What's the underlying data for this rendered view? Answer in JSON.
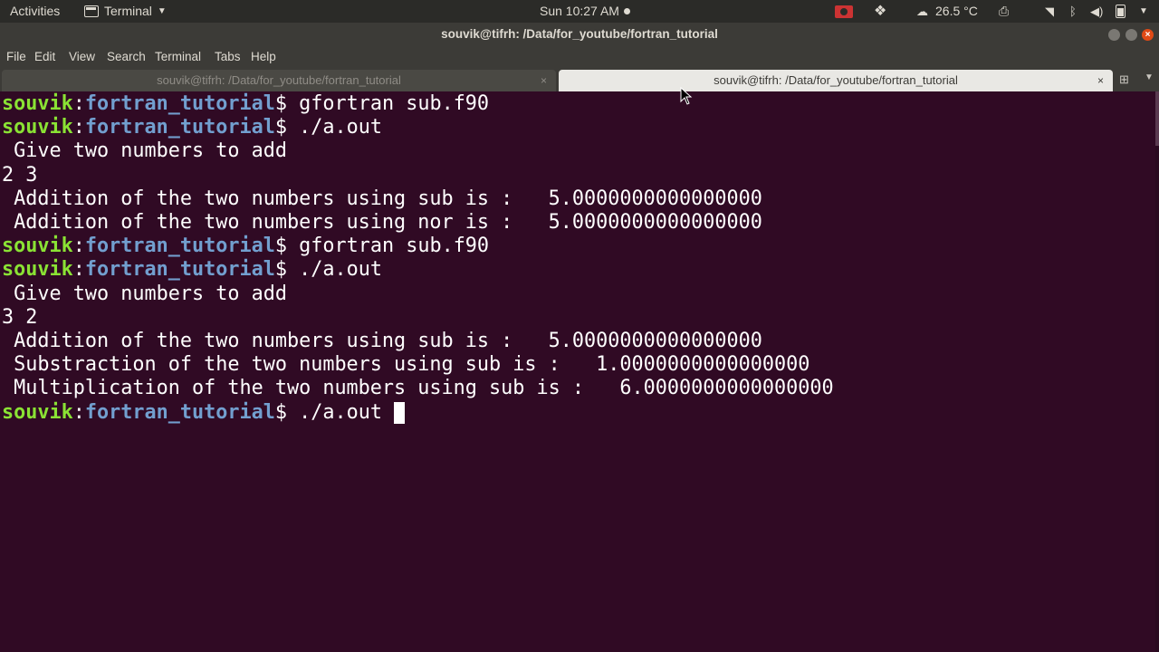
{
  "topbar": {
    "activities": "Activities",
    "app_name": "Terminal",
    "clock": "Sun 10:27 AM",
    "temperature": "26.5 °C",
    "icons": [
      "screen-record-icon",
      "dropbox-icon",
      "weather-icon",
      "printer-icon",
      "wifi-icon",
      "bluetooth-icon",
      "volume-icon",
      "battery-icon"
    ]
  },
  "window": {
    "title": "souvik@tifrh: /Data/for_youtube/fortran_tutorial"
  },
  "menu": {
    "file": "File",
    "edit": "Edit",
    "view": "View",
    "search": "Search",
    "terminal": "Terminal",
    "tabs": "Tabs",
    "help": "Help"
  },
  "tabs": [
    {
      "label": "souvik@tifrh: /Data/for_youtube/fortran_tutorial",
      "active": false
    },
    {
      "label": "souvik@tifrh: /Data/for_youtube/fortran_tutorial",
      "active": true
    }
  ],
  "prompt": {
    "user": "souvik",
    "colon": ":",
    "dir": "fortran_tutorial",
    "symbol": "$"
  },
  "terminal": {
    "lines": [
      {
        "type": "cmd",
        "text": " gfortran sub.f90"
      },
      {
        "type": "cmd",
        "text": " ./a.out"
      },
      {
        "type": "out",
        "text": " Give two numbers to add"
      },
      {
        "type": "out",
        "text": "2 3"
      },
      {
        "type": "out",
        "text": " Addition of the two numbers using sub is :   5.0000000000000000"
      },
      {
        "type": "out",
        "text": " Addition of the two numbers using nor is :   5.0000000000000000"
      },
      {
        "type": "cmd",
        "text": " gfortran sub.f90"
      },
      {
        "type": "cmd",
        "text": " ./a.out"
      },
      {
        "type": "out",
        "text": " Give two numbers to add"
      },
      {
        "type": "out",
        "text": "3 2"
      },
      {
        "type": "out",
        "text": " Addition of the two numbers using sub is :   5.0000000000000000"
      },
      {
        "type": "out",
        "text": " Substraction of the two numbers using sub is :   1.0000000000000000"
      },
      {
        "type": "out",
        "text": " Multiplication of the two numbers using sub is :   6.0000000000000000"
      },
      {
        "type": "cmd",
        "text": " ./a.out ",
        "cursor": true
      }
    ]
  },
  "colors": {
    "terminal_bg": "#300a24",
    "user": "#8ae234",
    "path": "#729fcf",
    "text": "#ffffff"
  }
}
